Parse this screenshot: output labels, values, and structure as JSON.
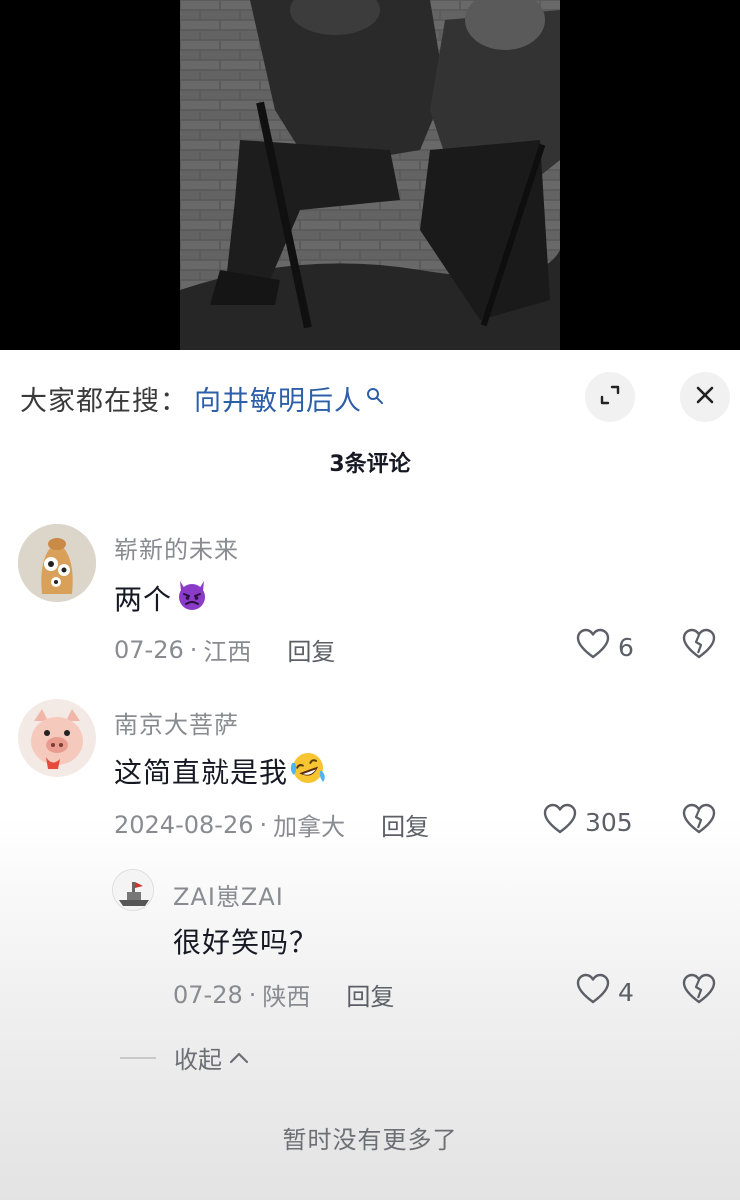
{
  "search_bar": {
    "label": "大家都在搜：",
    "term": "向井敏明后人"
  },
  "comment_count_label": "3条评论",
  "comments": [
    {
      "username": "崭新的未来",
      "text": "两个",
      "emoji": "devil-emoji",
      "date": "07-26",
      "location": "江西",
      "reply_label": "回复",
      "likes": "6"
    },
    {
      "username": "南京大菩萨",
      "text": "这简直就是我",
      "emoji": "rofl-emoji",
      "date": "2024-08-26",
      "location": "加拿大",
      "reply_label": "回复",
      "likes": "305",
      "replies": [
        {
          "username": "ZAI崽ZAI",
          "text": "很好笑吗？",
          "date": "07-28",
          "location": "陕西",
          "reply_label": "回复",
          "likes": "4"
        }
      ]
    }
  ],
  "collapse_label": "收起",
  "no_more_label": "暂时没有更多了",
  "sep": "·",
  "colors": {
    "search_term": "#2d5ea8",
    "secondary_text": "#8a8b91",
    "primary_text": "#161823"
  }
}
